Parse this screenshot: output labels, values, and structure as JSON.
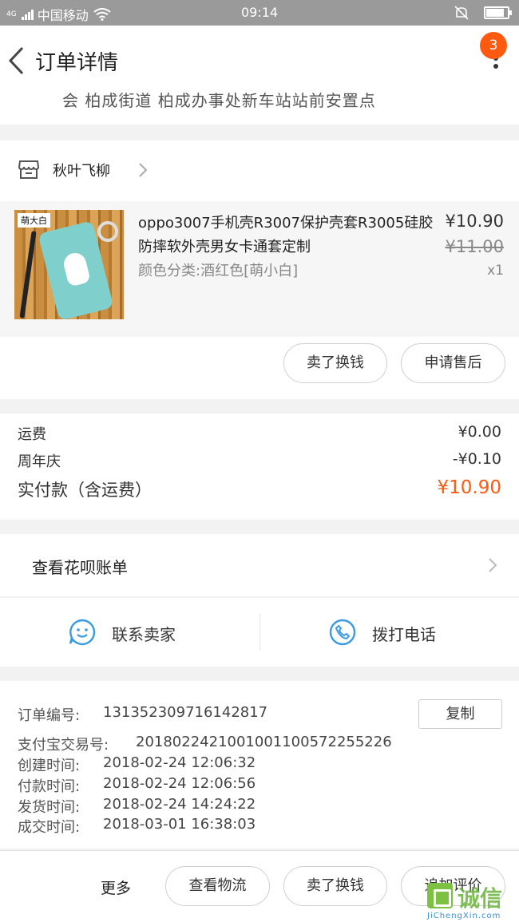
{
  "status_bar": {
    "network": "4G",
    "carrier": "中国移动",
    "time": "09:14",
    "battery_level": 0.85
  },
  "header": {
    "title": "订单详情",
    "badge_count": "3"
  },
  "address": {
    "text": "会 柏成街道 柏成办事处新车站站前安置点"
  },
  "shop": {
    "name": "秋叶飞柳"
  },
  "product": {
    "thumb_label": "萌大白",
    "title": "oppo3007手机壳R3007保护壳套R3005硅胶防摔软外壳男女卡通套定制",
    "sku": "颜色分类:酒红色[萌小白]",
    "price": "¥10.90",
    "original_price": "¥11.00",
    "quantity": "x1",
    "buttons": [
      "卖了换钱",
      "申请售后"
    ]
  },
  "totals": {
    "shipping_label": "运费",
    "shipping_value": "¥0.00",
    "promo_label": "周年庆",
    "promo_value": "-¥0.10",
    "paid_label": "实付款（含运费）",
    "paid_value": "¥10.90",
    "paid_color": "#ff5a0f"
  },
  "huabei": {
    "label": "查看花呗账单"
  },
  "contact": {
    "seller_label": "联系卖家",
    "seller_icon": "chat-face-icon",
    "phone_label": "拨打电话",
    "phone_icon": "phone-icon",
    "icon_color": "#3a9be0"
  },
  "order_info": {
    "copy_label": "复制",
    "rows": [
      {
        "key": "订单编号:",
        "value": "131352309716142817"
      },
      {
        "key": "支付宝交易号:",
        "value": "2018022421001001100572255226"
      },
      {
        "key": "创建时间:",
        "value": "2018-02-24 12:06:32"
      },
      {
        "key": "付款时间:",
        "value": "2018-02-24 12:06:56"
      },
      {
        "key": "发货时间:",
        "value": "2018-02-24 14:24:22"
      },
      {
        "key": "成交时间:",
        "value": "2018-03-01 16:38:03"
      }
    ]
  },
  "bottom_bar": {
    "more_label": "更多",
    "buttons": [
      "查看物流",
      "卖了换钱",
      "追加评价"
    ]
  },
  "watermark": {
    "cn": "诚信",
    "en": "JiChengXin.com"
  }
}
